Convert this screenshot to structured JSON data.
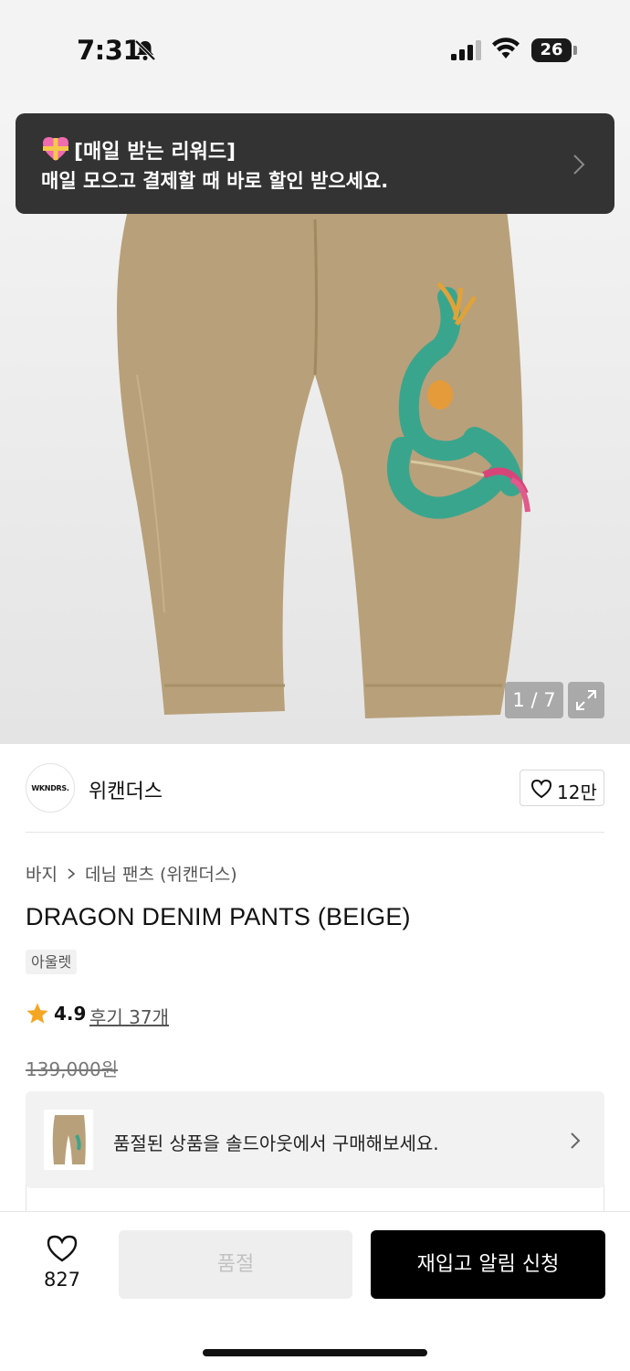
{
  "status_bar": {
    "time": "7:31",
    "battery": "26"
  },
  "gallery": {
    "counter": "1 / 7"
  },
  "reward_toast": {
    "title": "[매일 받는 리워드]",
    "subtitle": "매일 모으고 결제할 때 바로 할인 받으세요."
  },
  "brand": {
    "logo_text": "WKNDRS.",
    "name": "위캔더스",
    "like_count": "12만"
  },
  "breadcrumb": {
    "items": [
      "바지",
      "데님 팬츠 (위캔더스)"
    ]
  },
  "product": {
    "title": "DRAGON DENIM PANTS (BEIGE)",
    "badge": "아울렛",
    "rating": "4.9",
    "review_link": "후기 37개",
    "original_price": "139,000원"
  },
  "soldout_banner": {
    "text": "품절된 상품을 솔드아웃에서 구매해보세요."
  },
  "bottom_bar": {
    "wish_count": "827",
    "soldout_label": "품절",
    "restock_label": "재입고 알림 신청"
  },
  "colors": {
    "toast_bg": "#333333",
    "pants_beige": "#b8a07a",
    "dragon_teal": "#3aa58d",
    "primary_button": "#000000",
    "disabled_button": "#eeeeee",
    "star": "#f5a623"
  },
  "icons": [
    "bell-slash-icon",
    "signal-icon",
    "wifi-icon",
    "gift-heart-icon",
    "chevron-right-icon",
    "expand-icon",
    "heart-outline-icon",
    "star-icon"
  ]
}
